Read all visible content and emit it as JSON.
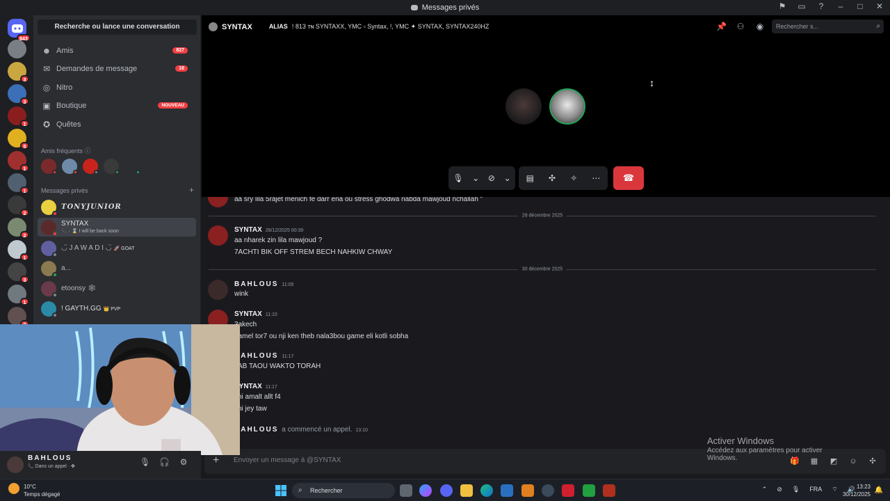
{
  "window": {
    "title": "Messages privés"
  },
  "server_rail": {
    "home_badge": "843",
    "servers": [
      {
        "badge": "",
        "color": "#7a7f86"
      },
      {
        "badge": "3",
        "color": "#c9a640"
      },
      {
        "badge": "3",
        "color": "#3b6fb8"
      },
      {
        "badge": "1",
        "color": "#8a1e1e"
      },
      {
        "badge": "5",
        "color": "#e0b020"
      },
      {
        "badge": "1",
        "color": "#a03030"
      },
      {
        "badge": "1",
        "color": "#506070"
      },
      {
        "badge": "2",
        "color": "#3a3a3a"
      },
      {
        "badge": "2",
        "color": "#7a8a70"
      },
      {
        "badge": "1",
        "color": "#c0c8d0"
      },
      {
        "badge": "3",
        "color": "#444"
      },
      {
        "badge": "1",
        "color": "#707880"
      },
      {
        "badge": "2",
        "color": "#605050"
      }
    ]
  },
  "sidebar": {
    "search_label": "Recherche ou lance une conversation",
    "nav": [
      {
        "label": "Amis",
        "icon": "friends-icon",
        "count": "827"
      },
      {
        "label": "Demandes de message",
        "icon": "mail-icon",
        "count": "16"
      },
      {
        "label": "Nitro",
        "icon": "nitro-icon",
        "count": ""
      },
      {
        "label": "Boutique",
        "icon": "shop-icon",
        "count": "NOUVEAU"
      },
      {
        "label": "Quêtes",
        "icon": "quest-icon",
        "count": ""
      }
    ],
    "frequent_header": "Amis fréquents",
    "dm_header": "Messages privés",
    "dms": [
      {
        "name": "TONYJUNIOR",
        "sub": "",
        "tag": ""
      },
      {
        "name": "SYNTAX",
        "sub": "I will be back soon",
        "tag": ""
      },
      {
        "name": "◡̈ J A W A D I ◡̈",
        "sub": "",
        "tag": "GOAT"
      },
      {
        "name": "a...",
        "sub": "",
        "tag": ""
      },
      {
        "name": "etoonsy 🕸",
        "sub": "",
        "tag": ""
      },
      {
        "name": "! GAYTH.GG",
        "sub": "",
        "tag": "PVP"
      }
    ]
  },
  "header": {
    "channel": "SYNTAX",
    "alias_label": "ALIAS",
    "members": "! 813 ᴛɴ SYNTAXX, YMC ▫ Syntax, !, YMC ✦ SYNTAX, SYNTAX240HZ",
    "search_placeholder": "Rechercher s..."
  },
  "messages": {
    "partial_line": "aa sry lila 5rajet menich fe darr ena ou stress ghodwa nabda mawjoud nchallah \"",
    "divider1": "28 décembre 2025",
    "m1_author": "SYNTAX",
    "m1_time": "28/12/2025 00:39",
    "m1_l1": "aa nharek zin lila mawjoud ?",
    "m1_l2": "7ACHTI BIK OFF STREM BECH NAHKIW CHWAY",
    "divider2": "30 décembre 2025",
    "m2_author": "BAHLOUS",
    "m2_time": "11:05",
    "m2_l1": "wink",
    "m3_author": "SYNTAX",
    "m3_time": "11:10",
    "m3_l1": "3akech",
    "m3_l2": "3amel tor7 ou nji  ken theb nala3bou game eli kotli sobha",
    "m4_author": "BAHLOUS",
    "m4_time": "11:17",
    "m4_l1": "JAB TAOU WAKTO TORAH",
    "m5_author": "SYNTAX",
    "m5_time": "11:17",
    "m5_l1": "chi amalt allt f4",
    "m5_l2": "chi jey taw",
    "m6_author": "BAHLOUS",
    "m6_text": "a commencé un appel.",
    "m6_time": "13:10",
    "activate_title": "Activer Windows",
    "activate_sub": "Accédez aux paramètres pour activer Windows."
  },
  "composer": {
    "placeholder": "Envoyer un message à @SYNTAX"
  },
  "user": {
    "name": "BAHLOUS",
    "status": "Dans un appel"
  },
  "taskbar": {
    "temp": "10°C",
    "weather": "Temps dégagé",
    "search": "Rechercher",
    "lang": "FRA",
    "time": "13:23",
    "date": "30/12/2025"
  }
}
